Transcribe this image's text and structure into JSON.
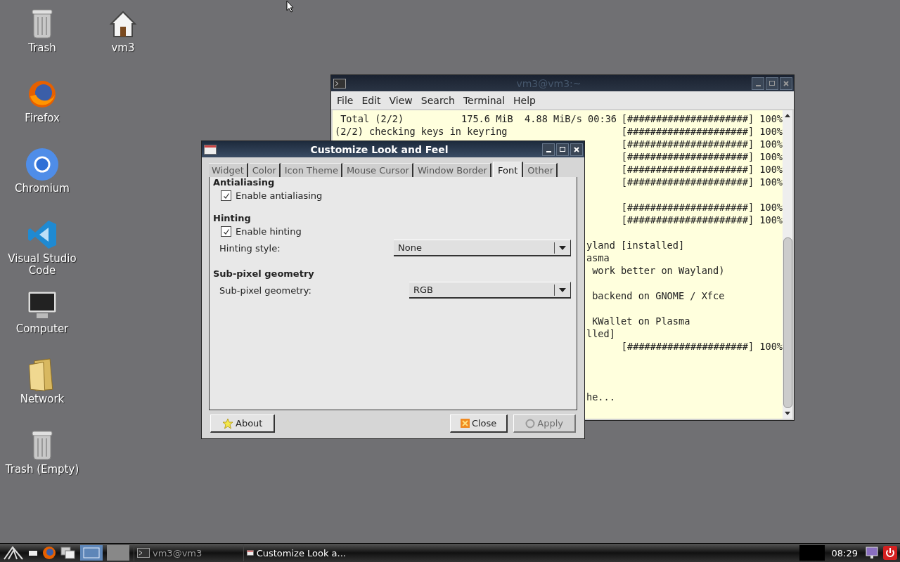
{
  "desktop_icons": [
    {
      "label": "Trash",
      "kind": "trash"
    },
    {
      "label": "Firefox",
      "kind": "firefox"
    },
    {
      "label": "Chromium",
      "kind": "chromium"
    },
    {
      "label": "Visual Studio Code",
      "kind": "vscode"
    },
    {
      "label": "Computer",
      "kind": "computer"
    },
    {
      "label": "Network",
      "kind": "folder"
    },
    {
      "label": "Trash (Empty)",
      "kind": "trash"
    },
    {
      "label": "vm3",
      "kind": "home"
    }
  ],
  "terminal": {
    "title": "vm3@vm3:~",
    "menu": [
      "File",
      "Edit",
      "View",
      "Search",
      "Terminal",
      "Help"
    ],
    "lines": [
      {
        "kind": "full",
        "left": " Total (2/2)          175.6 MiB  4.88 MiB/s 00:36",
        "right": "[#####################] 100%"
      },
      {
        "kind": "full",
        "left": "(2/2) checking keys in keyring",
        "right": "[#####################] 100%"
      },
      {
        "kind": "clipped",
        "right": "[#####################] 100%"
      },
      {
        "kind": "clipped",
        "right": "[#####################] 100%"
      },
      {
        "kind": "clipped",
        "right": "[#####################] 100%"
      },
      {
        "kind": "clipped",
        "right": "[#####################] 100%"
      },
      {
        "kind": "clipped"
      },
      {
        "kind": "clipped",
        "right": "[#####################] 100%"
      },
      {
        "kind": "clipped",
        "right": "[#####################] 100%"
      },
      {
        "kind": "clipped"
      },
      {
        "kind": "clipped",
        "left": "yland [installed]"
      },
      {
        "kind": "clipped",
        "left": "asma"
      },
      {
        "kind": "clipped",
        "left": " work better on Wayland)"
      },
      {
        "kind": "clipped"
      },
      {
        "kind": "clipped",
        "left": " backend on GNOME / Xfce"
      },
      {
        "kind": "clipped"
      },
      {
        "kind": "clipped",
        "left": " KWallet on Plasma"
      },
      {
        "kind": "clipped",
        "left": "lled]"
      },
      {
        "kind": "clipped",
        "right": "[#####################] 100%"
      },
      {
        "kind": "clipped"
      },
      {
        "kind": "clipped"
      },
      {
        "kind": "clipped"
      },
      {
        "kind": "clipped",
        "left": "he..."
      }
    ]
  },
  "dialog": {
    "title": "Customize Look and Feel",
    "tabs": [
      {
        "label": "Widget",
        "selected": false
      },
      {
        "label": "Color",
        "selected": false
      },
      {
        "label": "Icon Theme",
        "selected": false
      },
      {
        "label": "Mouse Cursor",
        "selected": false
      },
      {
        "label": "Window Border",
        "selected": false
      },
      {
        "label": "Font",
        "selected": true
      },
      {
        "label": "Other",
        "selected": false
      }
    ],
    "sections": [
      {
        "heading": "Antialiasing",
        "items": [
          {
            "kind": "checkbox",
            "label": "Enable antialiasing",
            "checked": true
          }
        ]
      },
      {
        "heading": "Hinting",
        "items": [
          {
            "kind": "checkbox",
            "label": "Enable hinting",
            "checked": true
          },
          {
            "kind": "dropdown",
            "label": "Hinting style:",
            "value": "None"
          }
        ]
      },
      {
        "heading": "Sub-pixel geometry",
        "items": [
          {
            "kind": "dropdown",
            "label": "Sub-pixel geometry:",
            "value": "RGB"
          }
        ]
      }
    ],
    "buttons": [
      {
        "label": "About",
        "kind": "star",
        "disabled": false
      },
      {
        "label": "Close",
        "kind": "close",
        "disabled": false
      },
      {
        "label": "Apply",
        "kind": "apply",
        "disabled": true
      }
    ]
  },
  "taskbar": {
    "tasks": [
      {
        "label": "vm3@vm3",
        "kind": "terminal"
      },
      {
        "label": "Customize Look a...",
        "kind": "dialog"
      }
    ],
    "clock": "08:29"
  }
}
